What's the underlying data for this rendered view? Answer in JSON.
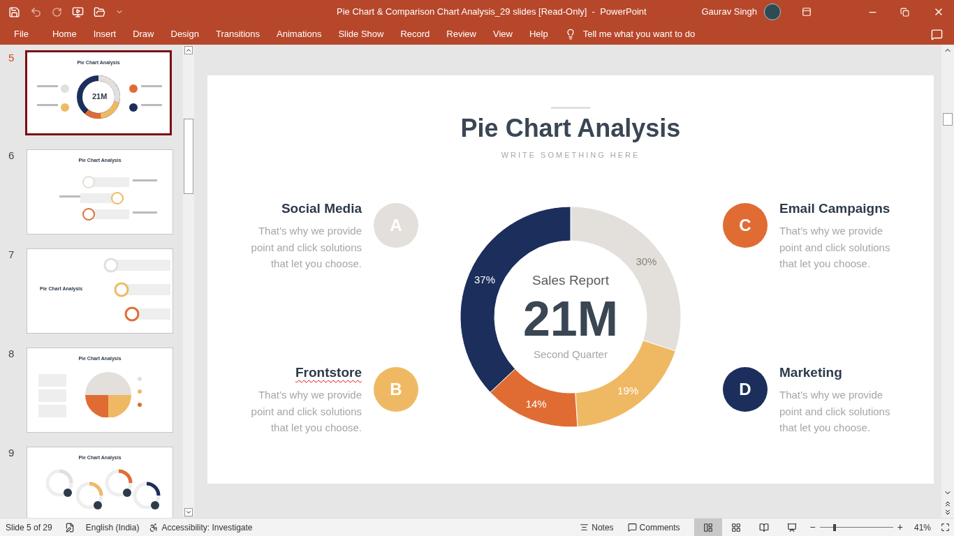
{
  "window": {
    "title": "Pie Chart & Comparison Chart Analysis_29 slides [Read-Only]  -  PowerPoint",
    "user": "Gaurav Singh"
  },
  "ribbon": {
    "tabs": [
      {
        "label": "File",
        "selected": false
      },
      {
        "label": "Home",
        "selected": false
      },
      {
        "label": "Insert",
        "selected": false
      },
      {
        "label": "Draw",
        "selected": false
      },
      {
        "label": "Design",
        "selected": false
      },
      {
        "label": "Transitions",
        "selected": false
      },
      {
        "label": "Animations",
        "selected": false
      },
      {
        "label": "Slide Show",
        "selected": false
      },
      {
        "label": "Record",
        "selected": false
      },
      {
        "label": "Review",
        "selected": false
      },
      {
        "label": "View",
        "selected": false
      },
      {
        "label": "Help",
        "selected": false
      }
    ],
    "tell_me": "Tell me what you want to do"
  },
  "thumbnails": [
    {
      "number": "5",
      "selected": true,
      "kind": "donut",
      "title": "Pie Chart Analysis",
      "value": "21M"
    },
    {
      "number": "6",
      "selected": false,
      "kind": "arrows",
      "title": "Pie Chart Analysis"
    },
    {
      "number": "7",
      "selected": false,
      "kind": "bars",
      "title": "Pie Chart Analysis"
    },
    {
      "number": "8",
      "selected": false,
      "kind": "pie",
      "title": "Pie Chart Analysis"
    },
    {
      "number": "9",
      "selected": false,
      "kind": "rings",
      "title": "Pie Chart Analysis"
    }
  ],
  "slide": {
    "title": "Pie Chart Analysis",
    "subtitle": "WRITE SOMETHING HERE",
    "left_items": [
      {
        "heading": "Social Media",
        "text": "That’s why we provide point and click solutions that let you choose.",
        "letter": "A",
        "color": "#e3dfda",
        "spellcheck": false
      },
      {
        "heading": "Frontstore",
        "text": "That’s why we provide point and click solutions that let you choose.",
        "letter": "B",
        "color": "#efb964",
        "spellcheck": true
      }
    ],
    "right_items": [
      {
        "heading": "Email Campaigns",
        "text": "That’s why we provide point and click solutions that let you choose.",
        "letter": "C",
        "color": "#e06c34",
        "spellcheck": false
      },
      {
        "heading": "Marketing",
        "text": "That’s why we provide point and click solutions that let you choose.",
        "letter": "D",
        "color": "#1c2e5c",
        "spellcheck": false
      }
    ],
    "center_label": "Sales Report",
    "center_value": "21M",
    "center_caption": "Second Quarter",
    "chart_data": {
      "type": "donut",
      "values": [
        30,
        19,
        14,
        37
      ],
      "value_labels": [
        "30%",
        "19%",
        "14%",
        "37%"
      ],
      "colors": [
        "#e3dfda",
        "#efb964",
        "#e06c34",
        "#1c2e5c"
      ]
    }
  },
  "status_bar": {
    "slide": "Slide 5 of 29",
    "language": "English (India)",
    "accessibility": "Accessibility: Investigate",
    "notes": "Notes",
    "comments": "Comments",
    "views": [
      {
        "kind": "normal",
        "selected": true
      },
      {
        "kind": "sorter",
        "selected": false
      },
      {
        "kind": "reading",
        "selected": false
      },
      {
        "kind": "slideshow",
        "selected": false
      }
    ],
    "zoom": {
      "level": 0.2,
      "reading": "41%",
      "minus": "−",
      "plus": "+"
    }
  }
}
